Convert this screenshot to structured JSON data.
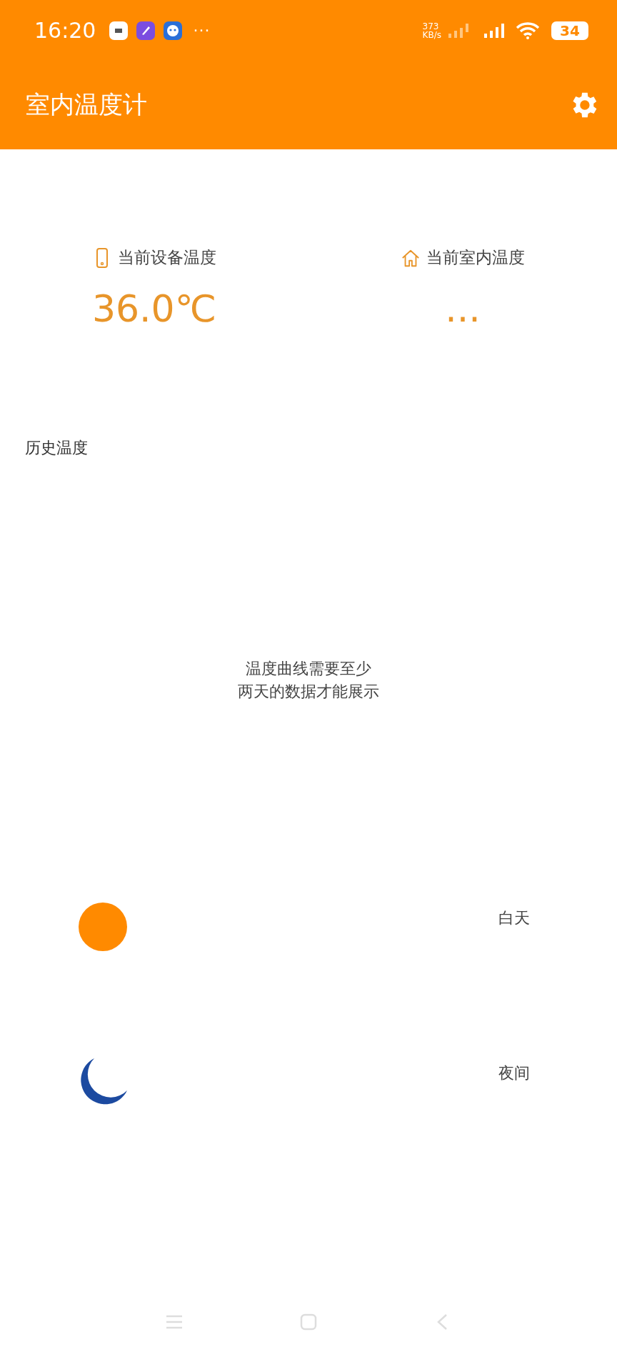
{
  "status_bar": {
    "time": "16:20",
    "notification_icons": [
      {
        "kind": "mi"
      },
      {
        "kind": "rocket"
      },
      {
        "kind": "ghost"
      }
    ],
    "more": "···",
    "net_speed": [
      "373",
      "KB/s"
    ],
    "battery": "34"
  },
  "app_bar": {
    "title": "室内温度计"
  },
  "readings": [
    {
      "kind": "device",
      "label": "当前设备温度",
      "value": "36.0℃"
    },
    {
      "kind": "indoor",
      "label": "当前室内温度",
      "value": "..."
    }
  ],
  "history": {
    "title": "历史温度",
    "empty_message": [
      "温度曲线需要至少",
      "两天的数据才能展示"
    ]
  },
  "legend": [
    {
      "kind": "sun",
      "label": "白天",
      "color": "#ff8a00"
    },
    {
      "kind": "moon",
      "label": "夜间",
      "color": "#1c4aa0"
    }
  ],
  "nav_bar": [
    {
      "kind": "menu"
    },
    {
      "kind": "home"
    },
    {
      "kind": "back"
    }
  ]
}
